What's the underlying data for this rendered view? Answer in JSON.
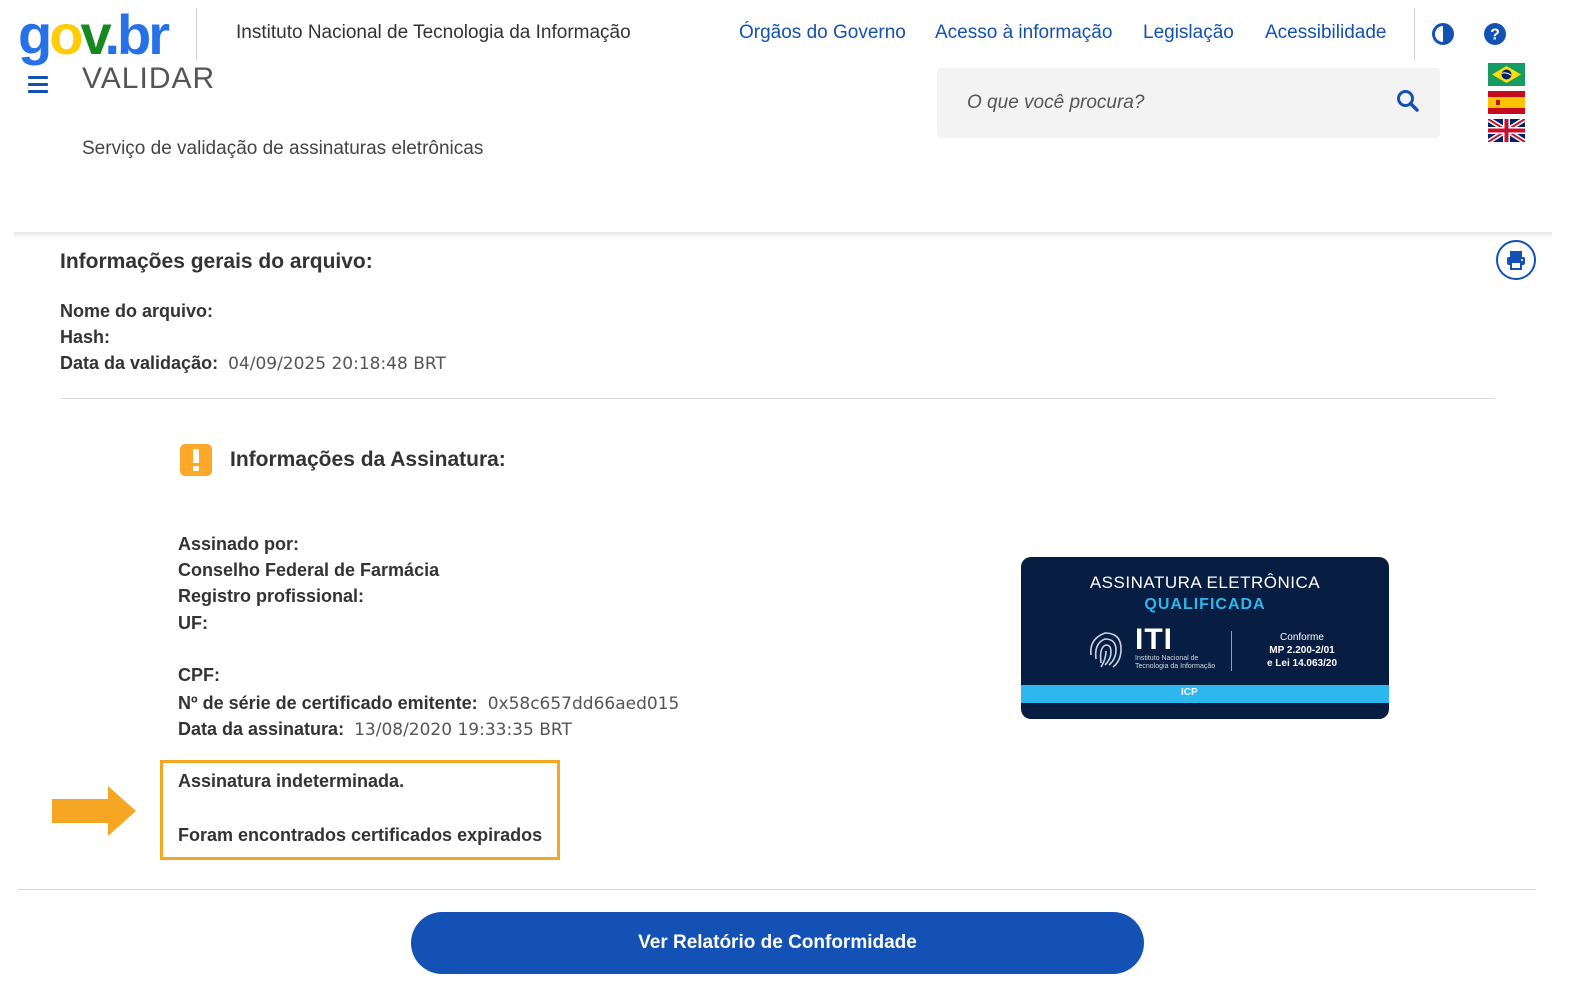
{
  "header": {
    "logo": {
      "g": "g",
      "o": "o",
      "v": "v",
      "dot": ".",
      "b": "b",
      "r": "r"
    },
    "institute": "Instituto Nacional de Tecnologia da Informação",
    "links": [
      "Órgãos do Governo",
      "Acesso à informação",
      "Legislação",
      "Acessibilidade"
    ],
    "contrast_icon": "contrast-icon",
    "help_icon": "help-icon",
    "app_title": "VALIDAR",
    "subtitle": "Serviço de validação de assinaturas eletrônicas",
    "search": {
      "placeholder": "O que você procura?",
      "icon": "search-icon"
    },
    "languages": [
      "pt-BR flag",
      "es flag",
      "en flag"
    ]
  },
  "file_info": {
    "title": "Informações gerais do arquivo:",
    "name_label": "Nome do arquivo:",
    "hash_label": "Hash:",
    "date_label": "Data da validação:",
    "date_value": "04/09/2025 20:18:48 BRT"
  },
  "signature": {
    "title": "Informações da Assinatura:",
    "signed_by_label": "Assinado por:",
    "signer": "Conselho Federal de Farmácia",
    "registry_label": "Registro profissional:",
    "uf_label": "UF:",
    "cpf_label": "CPF:",
    "serial_label": "Nº de série de certificado emitente:",
    "serial_value": "0x58c657dd66aed015",
    "date_label": "Data da assinatura:",
    "date_value": "13/08/2020 19:33:35 BRT",
    "status": "Assinatura indeterminada.",
    "status_detail": "Foram encontrados certificados expirados"
  },
  "badge": {
    "line1": "ASSINATURA ELETRÔNICA",
    "line2": "QUALIFICADA",
    "iti": "ITI",
    "iti_sub": "Instituto Nacional de Tecnologia da Informação",
    "conf1": "Conforme",
    "conf2": "MP 2.200-2/01",
    "conf3": "e Lei 14.063/20",
    "icp": "ICP"
  },
  "cta": {
    "label": "Ver Relatório de Conformidade"
  },
  "colors": {
    "primary": "#1351b4",
    "warning": "#ffa726",
    "highlight": "#f5a623",
    "badge_bg": "#071d41",
    "badge_accent": "#2cb8ef"
  }
}
